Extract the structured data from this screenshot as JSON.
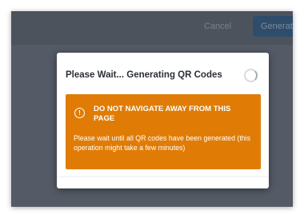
{
  "background": {
    "cancel_label": "Cancel",
    "generate_label": "Generate"
  },
  "modal": {
    "title": "Please Wait... Generating QR Codes",
    "alert": {
      "icon": "info-circle-icon",
      "icon_glyph": "!",
      "heading": "DO NOT NAVIGATE AWAY FROM THIS PAGE",
      "body": "Please wait until all QR codes have been generated (this operation might take a few minutes)"
    }
  },
  "colors": {
    "overlay": "#555b66",
    "alert_bg": "#e07c05",
    "modal_bg": "#ffffff"
  }
}
